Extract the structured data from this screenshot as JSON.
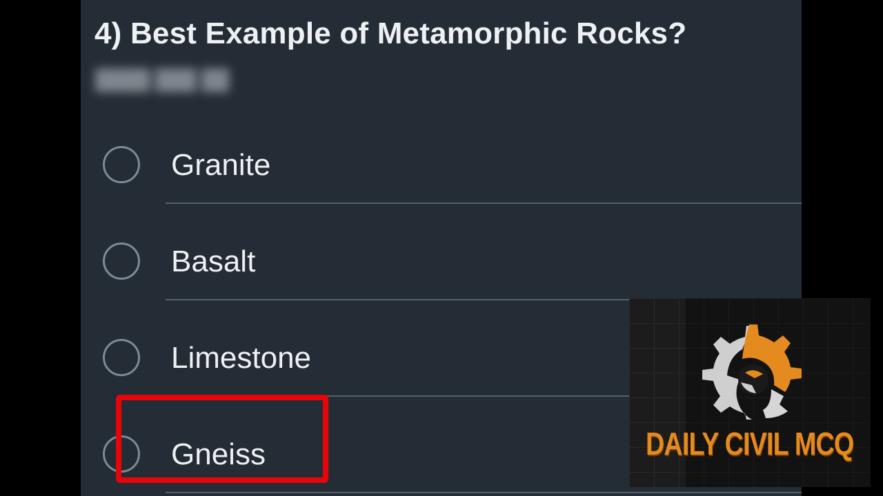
{
  "quiz": {
    "question": "4) Best Example of Metamorphic Rocks?",
    "options": [
      {
        "label": "Granite"
      },
      {
        "label": "Basalt"
      },
      {
        "label": "Limestone"
      },
      {
        "label": "Gneiss"
      }
    ],
    "highlighted_option": "Gneiss"
  },
  "brand": {
    "name": "DAILY CIVIL MCQ",
    "icon": "gear-icon",
    "colors": {
      "orange": "#e58a1f",
      "gray": "#c8c8c8"
    }
  },
  "colors": {
    "panel": "#242c35",
    "text": "#eef1f3",
    "highlight": "#e8050a"
  }
}
